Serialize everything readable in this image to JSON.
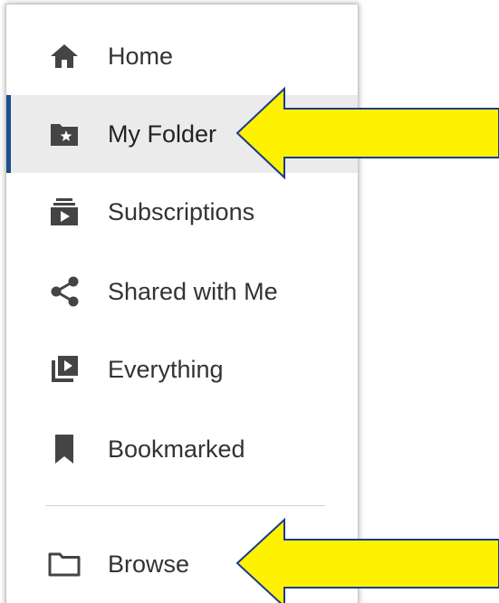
{
  "sidebar": {
    "items": [
      {
        "label": "Home",
        "icon": "home-icon"
      },
      {
        "label": "My Folder",
        "icon": "folder-star-icon",
        "active": true
      },
      {
        "label": "Subscriptions",
        "icon": "subscriptions-icon"
      },
      {
        "label": "Shared with Me",
        "icon": "share-icon"
      },
      {
        "label": "Everything",
        "icon": "video-library-icon"
      },
      {
        "label": "Bookmarked",
        "icon": "bookmark-icon"
      }
    ],
    "browse": {
      "label": "Browse",
      "icon": "folder-outline-icon"
    }
  },
  "colors": {
    "active_indicator": "#1f4d8f",
    "active_background": "#ebebeb",
    "icon": "#444444",
    "callout_arrow_fill": "#fff200",
    "callout_arrow_stroke": "#1a3a8c"
  }
}
